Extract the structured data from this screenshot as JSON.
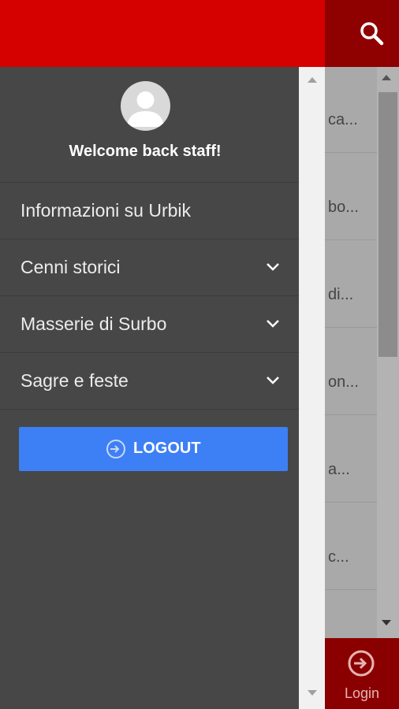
{
  "header": {
    "search_icon": "search-icon"
  },
  "background_list": {
    "rows": [
      "ca...",
      "bo...",
      "di...",
      "on...",
      "a...",
      "c..."
    ]
  },
  "bottom_nav": {
    "login_label": "Login",
    "login_icon": "login-icon"
  },
  "drawer": {
    "welcome": "Welcome back staff!",
    "avatar_icon": "user-avatar-icon",
    "items": [
      {
        "label": "Informazioni su Urbik",
        "expandable": false
      },
      {
        "label": "Cenni storici",
        "expandable": true
      },
      {
        "label": "Masserie di Surbo",
        "expandable": true
      },
      {
        "label": "Sagre e feste",
        "expandable": true
      }
    ],
    "logout_label": "LOGOUT"
  },
  "colors": {
    "header_red": "#d50000",
    "drawer_bg": "#474747",
    "logout_blue": "#3d7ff5",
    "login_dark_red": "#8a0000"
  }
}
